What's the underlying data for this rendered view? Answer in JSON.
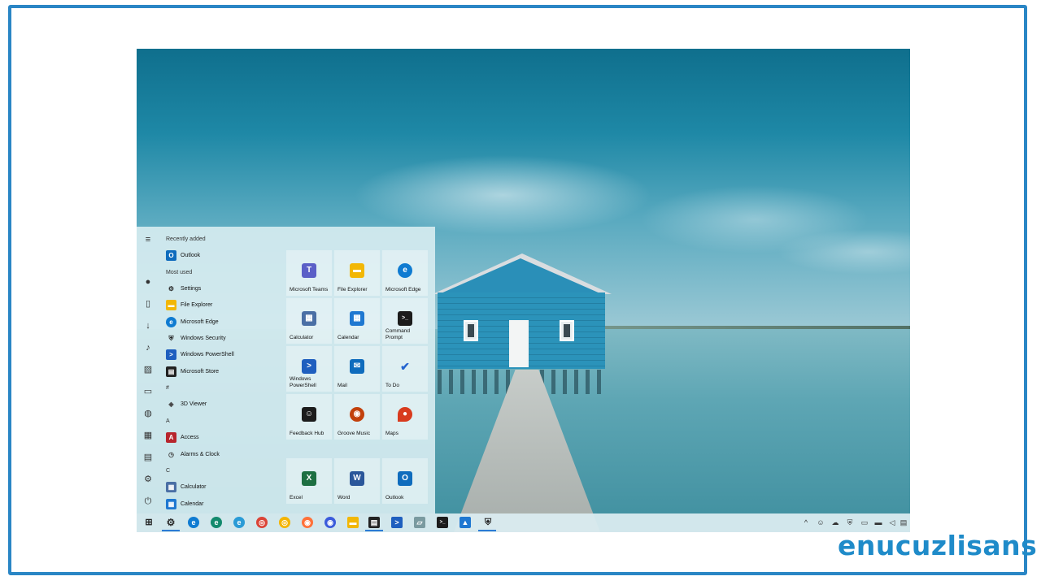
{
  "start_menu": {
    "recently_added_label": "Recently added",
    "most_used_label": "Most used",
    "recent_apps": [
      {
        "label": "Outlook",
        "icon": "outlook-icon",
        "color": "#0f6cbd",
        "glyph": "O"
      }
    ],
    "most_used_apps": [
      {
        "label": "Settings",
        "icon": "gear-icon",
        "color": "#2b2b2b",
        "glyph": "⚙"
      },
      {
        "label": "File Explorer",
        "icon": "folder-icon",
        "color": "#f2b705",
        "glyph": "▬"
      },
      {
        "label": "Microsoft Edge",
        "icon": "edge-icon",
        "color": "#0f7bd1",
        "glyph": "e"
      },
      {
        "label": "Windows Security",
        "icon": "shield-icon",
        "color": "#222",
        "glyph": "⛨"
      },
      {
        "label": "Windows PowerShell",
        "icon": "powershell-icon",
        "color": "#1f5fbf",
        "glyph": ">"
      },
      {
        "label": "Microsoft Store",
        "icon": "store-icon",
        "color": "#222",
        "glyph": "▤"
      }
    ],
    "section_hash": "#",
    "hash_apps": [
      {
        "label": "3D Viewer",
        "icon": "cube-icon",
        "color": "#444",
        "glyph": "◈"
      }
    ],
    "section_a": "A",
    "a_apps": [
      {
        "label": "Access",
        "icon": "access-icon",
        "color": "#b7252d",
        "glyph": "A"
      },
      {
        "label": "Alarms & Clock",
        "icon": "clock-icon",
        "color": "#444",
        "glyph": "◷"
      }
    ],
    "section_c": "C",
    "c_apps": [
      {
        "label": "Calculator",
        "icon": "calculator-icon",
        "color": "#4a6fa5",
        "glyph": "▦"
      },
      {
        "label": "Calendar",
        "icon": "calendar-icon",
        "color": "#1f78d1",
        "glyph": "▦"
      }
    ],
    "tiles": [
      {
        "label": "Microsoft Teams",
        "icon": "teams-icon",
        "color": "#5b5fc7",
        "glyph": "T"
      },
      {
        "label": "File Explorer",
        "icon": "folder-icon",
        "color": "#f2b705",
        "glyph": "▬"
      },
      {
        "label": "Microsoft Edge",
        "icon": "edge-icon",
        "color": "#0f7bd1",
        "glyph": "e"
      },
      {
        "label": "Calculator",
        "icon": "calculator-icon",
        "color": "#4a6fa5",
        "glyph": "▦"
      },
      {
        "label": "Calendar",
        "icon": "calendar-icon",
        "color": "#1f78d1",
        "glyph": "▦"
      },
      {
        "label": "Command Prompt",
        "icon": "terminal-icon",
        "color": "#1c1c1c",
        "glyph": ">_"
      },
      {
        "label": "Windows PowerShell",
        "icon": "powershell-icon",
        "color": "#1f5fbf",
        "glyph": ">"
      },
      {
        "label": "Mail",
        "icon": "mail-icon",
        "color": "#0f6cbd",
        "glyph": "✉"
      },
      {
        "label": "To Do",
        "icon": "check-icon",
        "color": "#2564cf",
        "glyph": "✔"
      },
      {
        "label": "Feedback Hub",
        "icon": "feedback-icon",
        "color": "#1c1c1c",
        "glyph": "☺"
      },
      {
        "label": "Groove Music",
        "icon": "music-icon",
        "color": "#c2410c",
        "glyph": "◉"
      },
      {
        "label": "Maps",
        "icon": "map-pin-icon",
        "color": "#d83b1e",
        "glyph": "●"
      },
      {
        "label": "Excel",
        "icon": "excel-icon",
        "color": "#1d6f42",
        "glyph": "X"
      },
      {
        "label": "Word",
        "icon": "word-icon",
        "color": "#2b579a",
        "glyph": "W"
      },
      {
        "label": "Outlook",
        "icon": "outlook-icon",
        "color": "#0f6cbd",
        "glyph": "O"
      }
    ]
  },
  "taskbar": {
    "apps": [
      {
        "icon": "gear-icon",
        "color": "#2b2b2b",
        "glyph": "⚙"
      },
      {
        "icon": "edge-icon",
        "color": "#0f7bd1",
        "glyph": "e"
      },
      {
        "icon": "edge-dev-icon",
        "color": "#138a6d",
        "glyph": "e"
      },
      {
        "icon": "edge-beta-icon",
        "color": "#2a9bd6",
        "glyph": "e"
      },
      {
        "icon": "chrome-icon",
        "color": "#db4437",
        "glyph": "◎"
      },
      {
        "icon": "chrome-canary-icon",
        "color": "#f4b400",
        "glyph": "◎"
      },
      {
        "icon": "firefox-icon",
        "color": "#ff7139",
        "glyph": "◉"
      },
      {
        "icon": "firefox-nightly-icon",
        "color": "#3b5bdb",
        "glyph": "◉"
      },
      {
        "icon": "folder-icon",
        "color": "#f2b705",
        "glyph": "▬"
      },
      {
        "icon": "store-icon",
        "color": "#222",
        "glyph": "▤"
      },
      {
        "icon": "powershell-icon",
        "color": "#1f5fbf",
        "glyph": ">"
      },
      {
        "icon": "notes-icon",
        "color": "#7a9aa0",
        "glyph": "▱"
      },
      {
        "icon": "terminal-icon",
        "color": "#1c1c1c",
        "glyph": ">_"
      },
      {
        "icon": "photos-icon",
        "color": "#1f78d1",
        "glyph": "▲"
      },
      {
        "icon": "shield-icon",
        "color": "#222",
        "glyph": "⛨"
      }
    ],
    "tray": [
      {
        "icon": "chevron-up-icon",
        "glyph": "^"
      },
      {
        "icon": "people-icon",
        "glyph": "☺"
      },
      {
        "icon": "cloud-icon",
        "glyph": "☁"
      },
      {
        "icon": "security-icon",
        "glyph": "⛨"
      },
      {
        "icon": "display-icon",
        "glyph": "▭"
      },
      {
        "icon": "network-icon",
        "glyph": "▬"
      },
      {
        "icon": "volume-icon",
        "glyph": "◁"
      },
      {
        "icon": "notification-icon",
        "glyph": "▤"
      }
    ]
  },
  "brand": {
    "logo_text": "enucuzlisans"
  }
}
